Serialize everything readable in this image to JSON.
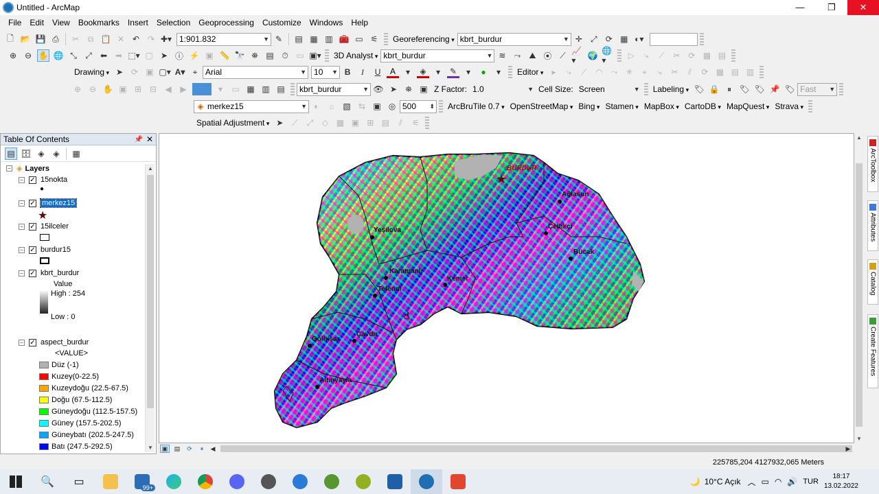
{
  "window": {
    "title": "Untitled - ArcMap",
    "minimize": "—",
    "maximize": "❐",
    "close": "✕"
  },
  "menu": [
    "File",
    "Edit",
    "View",
    "Bookmarks",
    "Insert",
    "Selection",
    "Geoprocessing",
    "Customize",
    "Windows",
    "Help"
  ],
  "toolbar1": {
    "scale": "1:901.832",
    "georeferencing": "Georeferencing",
    "georef_layer": "kbrt_burdur"
  },
  "toolbar2": {
    "analyst": "3D Analyst",
    "analyst_layer": "kbrt_burdur"
  },
  "toolbar3": {
    "drawing": "Drawing",
    "font": "Arial",
    "font_size": "10",
    "bold": "B",
    "italic": "I",
    "underline": "U",
    "text_tool": "A",
    "editor": "Editor"
  },
  "toolbar4": {
    "surface_layer": "kbrt_burdur",
    "zfactor_label": "Z Factor:",
    "zfactor": "1.0",
    "cellsize_label": "Cell Size:",
    "cellsize": "Screen",
    "labeling": "Labeling",
    "fast": "Fast"
  },
  "toolbar5": {
    "layer": "merkez15",
    "value": "500",
    "tiles": [
      "ArcBruTile 0.7",
      "OpenStreetMap",
      "Bing",
      "Stamen",
      "MapBox",
      "CartoDB",
      "MapQuest",
      "Strava"
    ]
  },
  "toolbar6": {
    "spatial_adjustment": "Spatial Adjustment"
  },
  "toc": {
    "title": "Table Of Contents",
    "root": "Layers",
    "layers": [
      {
        "name": "15nokta"
      },
      {
        "name": "merkez15"
      },
      {
        "name": "15ilceler"
      },
      {
        "name": "burdur15"
      },
      {
        "name": "kbrt_burdur",
        "legend_title": "Value",
        "high": "High : 254",
        "low": "Low : 0"
      },
      {
        "name": "aspect_burdur",
        "legend_title": "<VALUE>"
      }
    ],
    "aspect_classes": [
      {
        "label": "Düz (-1)",
        "color": "#b2b2b2"
      },
      {
        "label": "Kuzey(0-22.5)",
        "color": "#ff0000"
      },
      {
        "label": "Kuzeydoğu (22.5-67.5)",
        "color": "#ffa500"
      },
      {
        "label": "Doğu (67.5-112.5)",
        "color": "#ffff00"
      },
      {
        "label": "Güneydoğu (112.5-157.5)",
        "color": "#00ff00"
      },
      {
        "label": "Güney (157.5-202.5)",
        "color": "#00ffff"
      },
      {
        "label": "Güneybatı (202.5-247.5)",
        "color": "#00a5ff"
      },
      {
        "label": "Batı (247.5-292.5)",
        "color": "#0000ff"
      }
    ]
  },
  "map": {
    "places": [
      {
        "name": "BURDUR"
      },
      {
        "name": "Ağlasun"
      },
      {
        "name": "Yeşilova"
      },
      {
        "name": "Çeltikçi"
      },
      {
        "name": "Bucak"
      },
      {
        "name": "Karamanlı"
      },
      {
        "name": "Kemer"
      },
      {
        "name": "Tefenni"
      },
      {
        "name": "Gölhisar"
      },
      {
        "name": "Çavdır"
      },
      {
        "name": "Altınyayla"
      }
    ]
  },
  "sidetabs": [
    "ArcToolbox",
    "Attributes",
    "Catalog",
    "Create Features"
  ],
  "status": {
    "coords": "225785,204  4127932,065 Meters"
  },
  "taskbar": {
    "badge": "99+",
    "weather": "10°C  Açık",
    "lang": "TUR",
    "time": "18:17",
    "date": "13.02.2022"
  }
}
